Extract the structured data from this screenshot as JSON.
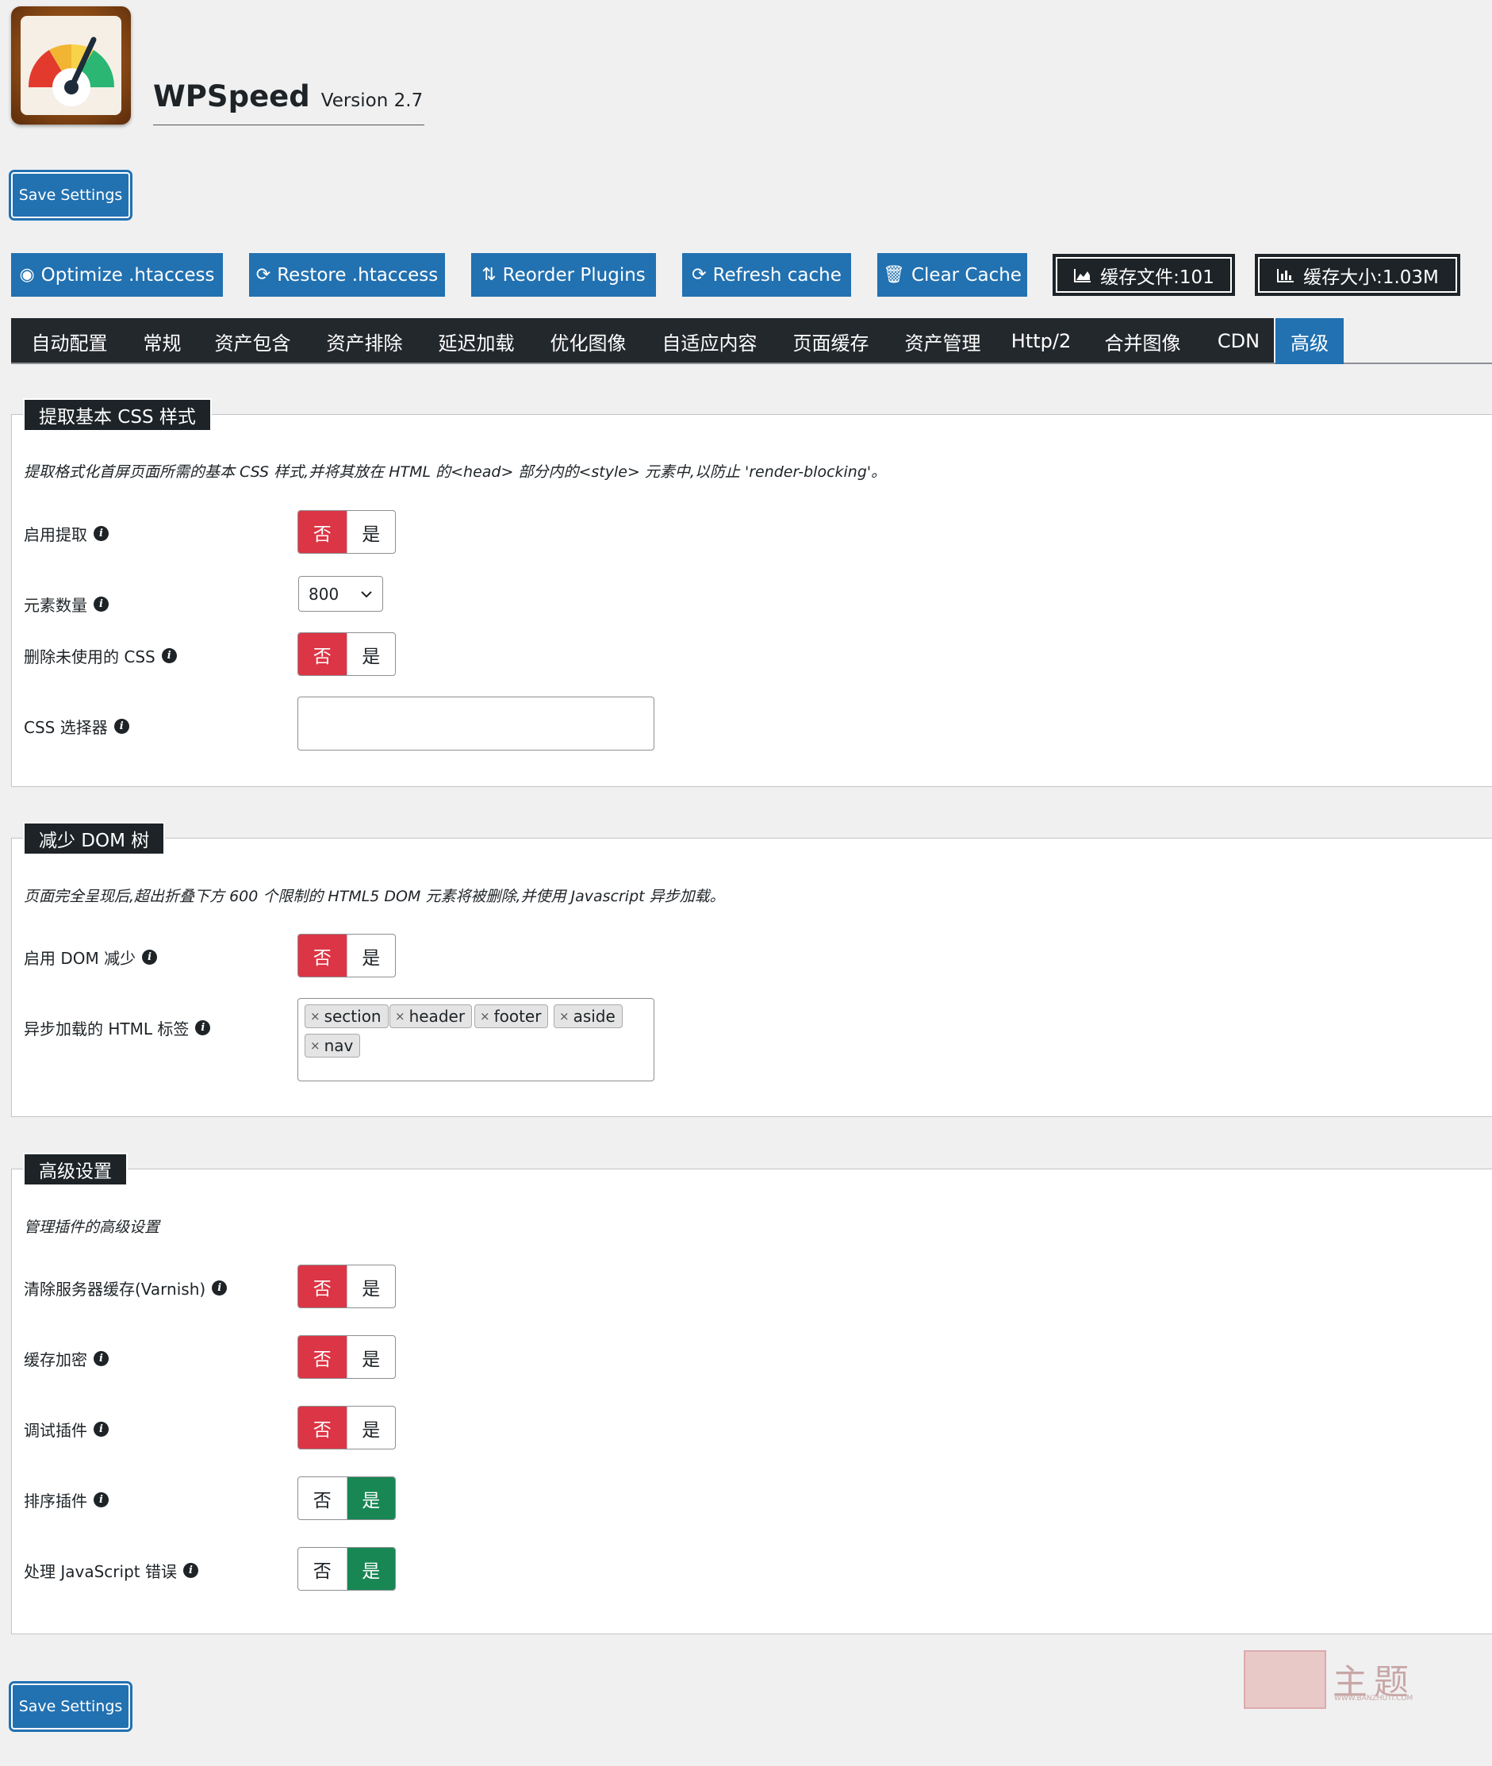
{
  "header": {
    "app_name": "WPSpeed",
    "version": "Version 2.7"
  },
  "save_label": "Save Settings",
  "toolbar": [
    {
      "icon": "gauge-icon",
      "glyph": "◉",
      "label": "Optimize .htaccess"
    },
    {
      "icon": "refresh-icon",
      "glyph": "⟳",
      "label": "Restore .htaccess"
    },
    {
      "icon": "sort-icon",
      "glyph": "⇅",
      "label": "Reorder Plugins"
    },
    {
      "icon": "refresh-icon",
      "glyph": "⟳",
      "label": "Refresh cache"
    },
    {
      "icon": "trash-icon",
      "glyph": "🗑",
      "label": "Clear Cache"
    }
  ],
  "cache_files": {
    "icon": "area-chart-icon",
    "label": "缓存文件:101"
  },
  "cache_size": {
    "icon": "bar-chart-icon",
    "label": "缓存大小:1.03M"
  },
  "tabs": [
    "自动配置",
    "常规",
    "资产包含",
    "资产排除",
    "延迟加载",
    "优化图像",
    "自适应内容",
    "页面缓存",
    "资产管理",
    "Http/2",
    "合并图像",
    "CDN",
    "高级"
  ],
  "active_tab": "高级",
  "sections": {
    "critical_css": {
      "title": "提取基本 CSS 样式",
      "description": "提取格式化首屏页面所需的基本 CSS 样式,并将其放在 HTML 的<head> 部分内的<style> 元素中,以防止 'render-blocking'。",
      "enable_label": "启用提取",
      "enable_value": "否",
      "count_label": "元素数量",
      "count_value": "800",
      "remove_unused_label": "删除未使用的 CSS",
      "remove_unused_value": "否",
      "selector_label": "CSS 选择器",
      "selector_value": ""
    },
    "dom": {
      "title": "减少 DOM 树",
      "description": "页面完全呈现后,超出折叠下方 600 个限制的 HTML5 DOM 元素将被删除,并使用 Javascript 异步加载。",
      "enable_label": "启用 DOM 减少",
      "enable_value": "否",
      "tags_label": "异步加载的 HTML 标签",
      "tags": [
        "section",
        "header",
        "footer",
        "aside",
        "nav"
      ]
    },
    "advanced": {
      "title": "高级设置",
      "description": "管理插件的高级设置",
      "purge_label": "清除服务器缓存(Varnish)",
      "purge_value": "否",
      "encrypt_label": "缓存加密",
      "encrypt_value": "否",
      "debug_label": "调试插件",
      "debug_value": "否",
      "order_label": "排序插件",
      "order_value": "是",
      "js_errors_label": "处理 JavaScript 错误",
      "js_errors_value": "是"
    }
  },
  "toggle_no": "否",
  "toggle_yes": "是",
  "remove_tag_glyph": "×",
  "info_glyph": "i",
  "watermark": {
    "text": "主题",
    "url": "WWW.BANZHUTI.COM"
  },
  "colors": {
    "primary": "#2271b1",
    "dark": "#1d2327",
    "no_active": "#dc3545",
    "yes_active": "#198754"
  }
}
